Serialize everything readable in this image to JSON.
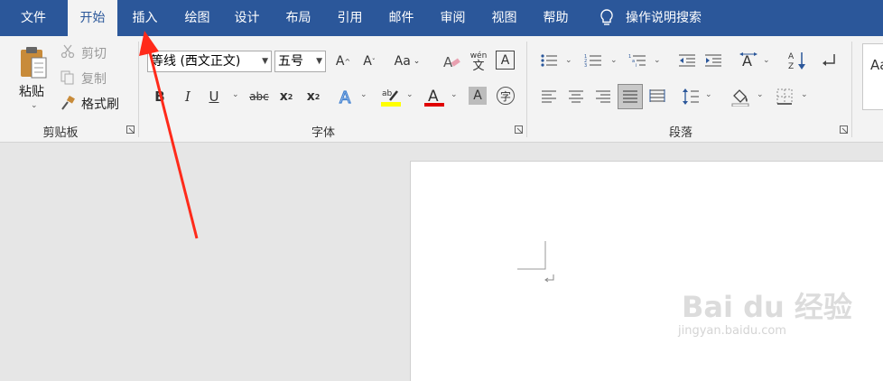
{
  "menu": {
    "tabs": [
      "文件",
      "开始",
      "插入",
      "绘图",
      "设计",
      "布局",
      "引用",
      "邮件",
      "审阅",
      "视图",
      "帮助"
    ],
    "active": "开始",
    "search_label": "操作说明搜索"
  },
  "clipboard": {
    "paste": "粘贴",
    "cut": "剪切",
    "copy": "复制",
    "format_painter": "格式刷",
    "group_label": "剪贴板"
  },
  "font": {
    "name": "等线 (西文正文)",
    "size": "五号",
    "change_case": "Aa",
    "phonetic_top": "wén",
    "phonetic_bottom": "文",
    "group_label": "字体",
    "colors": {
      "highlight": "#ffff00",
      "font_color": "#e00000"
    }
  },
  "paragraph": {
    "group_label": "段落"
  },
  "styles": {
    "preview": "Aa"
  },
  "watermark": {
    "brand": "Bai du 经验",
    "url": "jingyan.baidu.com"
  },
  "colors": {
    "accent": "#2b579a",
    "annotation_arrow": "#ff2a1a"
  }
}
